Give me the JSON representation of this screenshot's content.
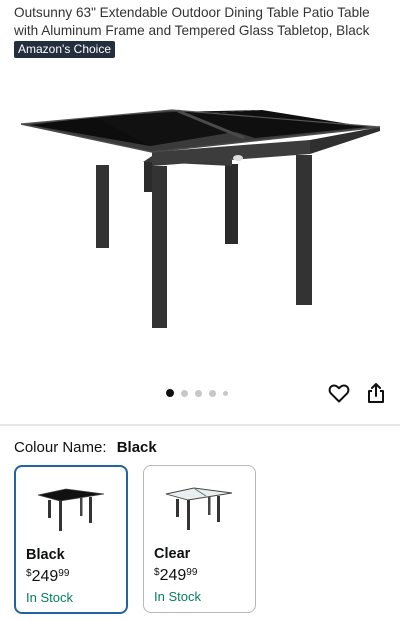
{
  "product": {
    "title": "Outsunny 63\" Extendable Outdoor Dining Table Patio Table with Aluminum Frame and Tempered Glass Tabletop, Black",
    "badge": "Amazon's Choice"
  },
  "gallery": {
    "dots": 5,
    "active_index": 0,
    "image_icon": "extendable-glass-patio-table"
  },
  "actions": {
    "favorite_icon": "heart-outline-icon",
    "share_icon": "share-icon"
  },
  "colour": {
    "label": "Colour Name:",
    "selected_value": "Black",
    "options": [
      {
        "name": "Black",
        "currency": "$",
        "price_whole": "249",
        "price_fraction": "99",
        "stock": "In Stock",
        "selected": true
      },
      {
        "name": "Clear",
        "currency": "$",
        "price_whole": "249",
        "price_fraction": "99",
        "stock": "In Stock",
        "selected": false
      }
    ]
  },
  "colors": {
    "badge_bg": "#232f3e",
    "selected_border": "#2162a1",
    "in_stock": "#067d62"
  }
}
